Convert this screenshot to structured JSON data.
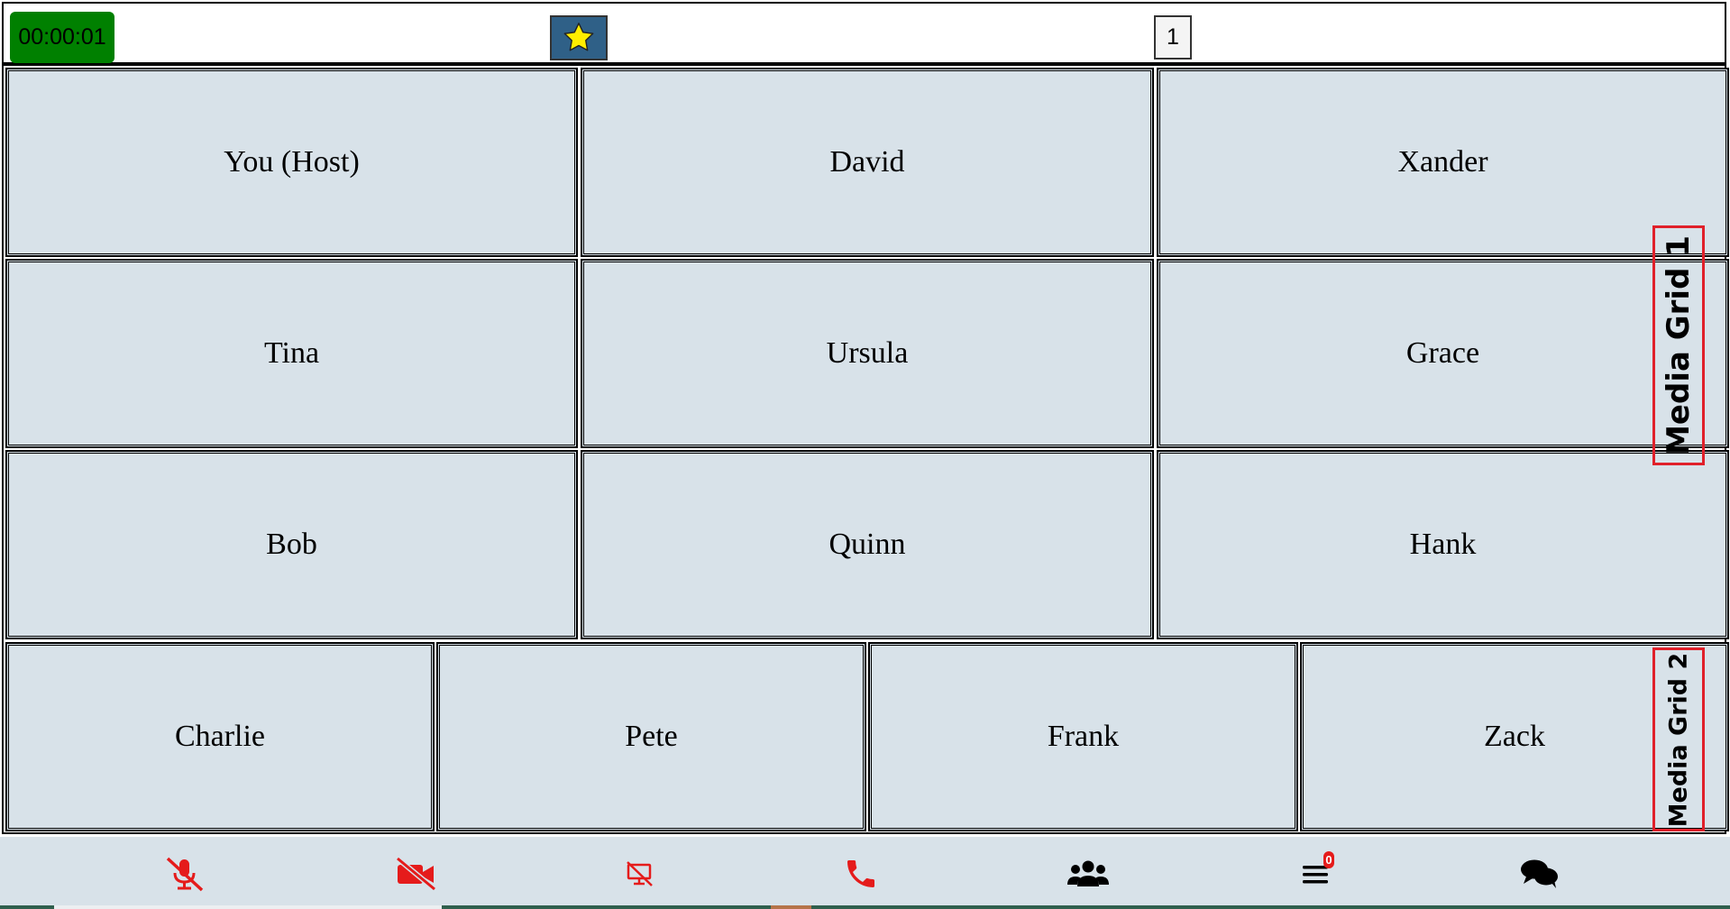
{
  "header": {
    "timer": "00:00:01",
    "page_number": "1"
  },
  "grid1": {
    "label": "Media Grid 1",
    "participants": [
      "You (Host)",
      "David",
      "Xander",
      "Tina",
      "Ursula",
      "Grace",
      "Bob",
      "Quinn",
      "Hank"
    ]
  },
  "grid2": {
    "label": "Media Grid 2",
    "participants": [
      "Charlie",
      "Pete",
      "Frank",
      "Zack"
    ]
  },
  "controls": {
    "icons": [
      "microphone-muted-icon",
      "video-off-icon",
      "screen-share-off-icon",
      "phone-end-icon",
      "participants-icon",
      "menu-icon",
      "chat-icon"
    ],
    "menu_badge": "0"
  },
  "colors": {
    "timer_bg": "#008000",
    "tile_bg": "#d8e2e9",
    "grid_label_border": "#e0202a",
    "control_red": "#e51b1b",
    "star_button_bg": "#2f6087",
    "star": "#ffee00"
  }
}
